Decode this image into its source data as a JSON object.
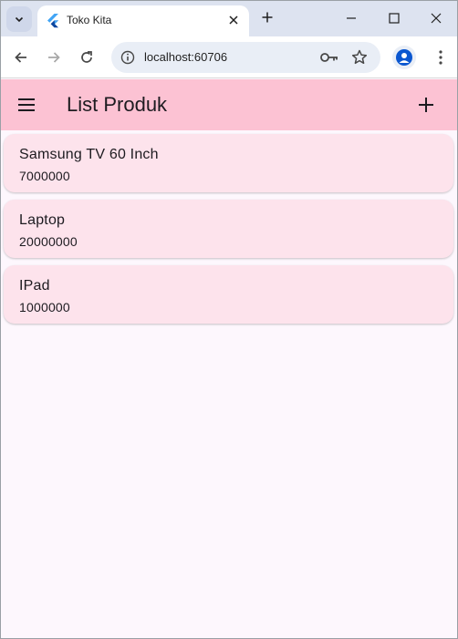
{
  "browser": {
    "tab_title": "Toko Kita",
    "url": "localhost:60706",
    "icons": {
      "tab_search": "chevron-down-icon",
      "favicon": "flutter-icon",
      "tab_close": "close-icon",
      "new_tab": "plus-icon",
      "minimize": "minimize-icon",
      "maximize": "maximize-icon",
      "close_window": "close-icon",
      "back": "arrow-left-icon",
      "forward": "arrow-right-icon",
      "reload": "reload-icon",
      "site_info": "info-icon",
      "password_key": "key-icon",
      "bookmark": "star-icon",
      "profile": "person-icon",
      "menu": "more-vertical-icon"
    }
  },
  "app": {
    "title": "List Produk",
    "colors": {
      "appbar": "#fcc2d3",
      "card": "#fde3ec",
      "background": "#fdf7fd"
    },
    "icons": {
      "drawer": "menu-icon",
      "add": "plus-icon"
    },
    "products": [
      {
        "name": "Samsung TV 60 Inch",
        "price": "7000000"
      },
      {
        "name": "Laptop",
        "price": "20000000"
      },
      {
        "name": "IPad",
        "price": "1000000"
      }
    ]
  }
}
